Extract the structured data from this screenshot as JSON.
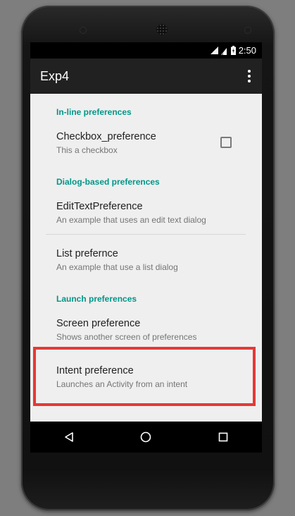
{
  "status_bar": {
    "time": "2:50"
  },
  "app_bar": {
    "title": "Exp4"
  },
  "preferences": {
    "inline_category": "In-line preferences",
    "checkbox": {
      "title": "Checkbox_preference",
      "summary": "This a checkbox",
      "checked": false
    },
    "dialog_category": "Dialog-based preferences",
    "edittext": {
      "title": "EditTextPreference",
      "summary": "An example that uses an edit text dialog"
    },
    "list": {
      "title": "List prefernce",
      "summary": "An example that use a list dialog"
    },
    "launch_category": "Launch preferences",
    "screen": {
      "title": "Screen preference",
      "summary": "Shows another screen of preferences"
    },
    "intent": {
      "title": "Intent preference",
      "summary": "Launches an Activity from an intent"
    }
  },
  "colors": {
    "accent": "#009688",
    "highlight": "#e53935",
    "app_bar": "#212121",
    "background": "#efefef"
  },
  "icons": [
    "wifi-icon",
    "signal-icon",
    "battery-icon",
    "overflow-menu-icon",
    "back-icon",
    "home-icon",
    "recents-icon"
  ]
}
